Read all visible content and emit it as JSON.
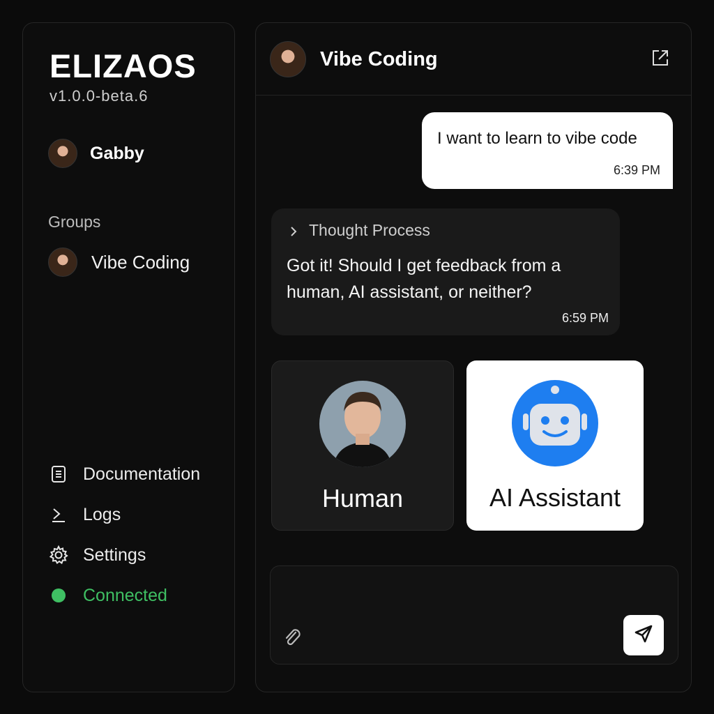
{
  "app": {
    "name": "ELIZAOS",
    "version": "v1.0.0-beta.6"
  },
  "sidebar": {
    "user": {
      "name": "Gabby"
    },
    "groups_label": "Groups",
    "groups": [
      {
        "name": "Vibe Coding"
      }
    ],
    "nav": [
      {
        "label": "Documentation",
        "icon": "document-icon"
      },
      {
        "label": "Logs",
        "icon": "terminal-icon"
      },
      {
        "label": "Settings",
        "icon": "gear-icon"
      },
      {
        "label": "Connected",
        "icon": "status-dot-icon",
        "color": "#3fbf63"
      }
    ]
  },
  "chat": {
    "title": "Vibe Coding",
    "messages": [
      {
        "role": "user",
        "text": "I want to learn to vibe code",
        "time": "6:39 PM"
      },
      {
        "role": "agent",
        "thought_label": "Thought Process",
        "text": "Got it! Should I get feedback from a human, AI assistant, or neither?",
        "time": "6:59 PM"
      }
    ],
    "choices": [
      {
        "label": "Human",
        "icon": "human-avatar-icon"
      },
      {
        "label": "AI Assistant",
        "icon": "robot-icon",
        "color": "#1e7ef0"
      }
    ],
    "composer": {
      "placeholder": ""
    }
  }
}
